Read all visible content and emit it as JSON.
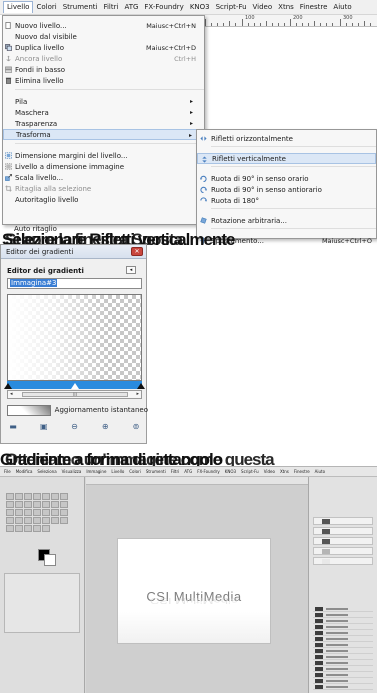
{
  "menubar": {
    "items": [
      "Livello",
      "Colori",
      "Strumenti",
      "Filtri",
      "ATG",
      "FX-Foundry",
      "KNO3",
      "Script-Fu",
      "Video",
      "Xtns",
      "Finestre",
      "Aiuto"
    ],
    "active": "Livello"
  },
  "ruler": {
    "labels": [
      "100",
      "200",
      "300"
    ]
  },
  "layer_menu": {
    "items": [
      {
        "label": "Nuovo livello...",
        "shortcut": "Maiusc+Ctrl+N",
        "icon": "new-layer-icon"
      },
      {
        "label": "Nuovo dal visibile",
        "shortcut": ""
      },
      {
        "label": "Duplica livello",
        "shortcut": "Maiusc+Ctrl+D",
        "icon": "duplicate-layer-icon"
      },
      {
        "label": "Ancora livello",
        "shortcut": "Ctrl+H",
        "icon": "anchor-icon",
        "disabled": true
      },
      {
        "label": "Fondi in basso",
        "shortcut": "",
        "icon": "merge-down-icon",
        "disabled_text": true
      },
      {
        "label": "Elimina livello",
        "shortcut": "",
        "icon": "delete-layer-icon"
      },
      {
        "label": "Pila",
        "submenu": true
      },
      {
        "label": "Maschera",
        "submenu": true
      },
      {
        "label": "Trasparenza",
        "submenu": true
      },
      {
        "label": "Trasforma",
        "submenu": true,
        "highlighted": true
      },
      {
        "label": "Dimensione margini del livello...",
        "icon": "layer-boundary-icon"
      },
      {
        "label": "Livello a dimensione immagine",
        "icon": "layer-to-image-icon"
      },
      {
        "label": "Scala livello...",
        "icon": "scale-layer-icon"
      },
      {
        "label": "Ritaglia alla selezione",
        "icon": "crop-icon",
        "disabled": true
      },
      {
        "label": "Autoritaglio livello"
      }
    ]
  },
  "transform_submenu": {
    "items": [
      {
        "label": "Rifletti orizzontalmente",
        "icon": "flip-horizontal-icon"
      },
      {
        "label": "Rifletti verticalmente",
        "icon": "flip-vertical-icon",
        "highlighted": true
      },
      {
        "label": "Ruota di 90° in senso orario",
        "icon": "rotate-cw-icon"
      },
      {
        "label": "Ruota di 90° in senso antiorario",
        "icon": "rotate-ccw-icon"
      },
      {
        "label": "Ruota di 180°",
        "icon": "rotate-180-icon"
      },
      {
        "label": "Rotazione arbitraria...",
        "icon": "rotate-arbitrary-icon"
      },
      {
        "label": "Spostamento...",
        "shortcut": "Maiusc+Ctrl+O",
        "icon": "offset-icon"
      }
    ]
  },
  "autocrop_label": "Auto ritaglio",
  "heading1": {
    "text_a": "Selezionare Rifletti verticalmente",
    "text_b": "Si apre la finestra Sposta"
  },
  "gradient_editor": {
    "window_title": "Editor dei gradienti",
    "panel_title": "Editor dei gradienti",
    "name_value": "Immagina#3",
    "update_label": "Aggiornamento istantaneo",
    "scroll_label": "III"
  },
  "heading2": {
    "text_a": "Gradiente a forma di rettangolo",
    "text_b": "Otteniamo un'immagine come questa"
  },
  "gimp_screenshot": {
    "menubar_items": [
      "File",
      "Modifica",
      "Seleziona",
      "Visualizza",
      "Immagine",
      "Livello",
      "Colori",
      "Strumenti",
      "Filtri",
      "ATG",
      "FX-Foundry",
      "KNO3",
      "Script-Fu",
      "Video",
      "Xtns",
      "Finestre",
      "Aiuto"
    ],
    "logo_text": "CSI MultiMedia"
  }
}
